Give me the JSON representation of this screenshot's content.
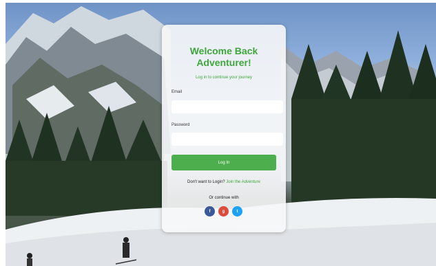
{
  "card": {
    "title_line1": "Welcome Back",
    "title_line2": "Adventurer!",
    "subtitle": "Log in to continue your journey",
    "email_label": "Email",
    "email_value": "",
    "password_label": "Password",
    "password_value": "",
    "login_label": "Log In",
    "signup_prompt": "Don't want to Login?",
    "signup_link": "Join the Adventure",
    "or_text": "Or continue with"
  },
  "social": [
    {
      "glyph": "f",
      "color": "#3b5998",
      "icon": "facebook-icon"
    },
    {
      "glyph": "g",
      "color": "#dd4b39",
      "icon": "google-icon"
    },
    {
      "glyph": "t",
      "color": "#1da1f2",
      "icon": "twitter-icon"
    }
  ],
  "colors": {
    "accent": "#3fa63a",
    "button": "#4cae4c"
  }
}
